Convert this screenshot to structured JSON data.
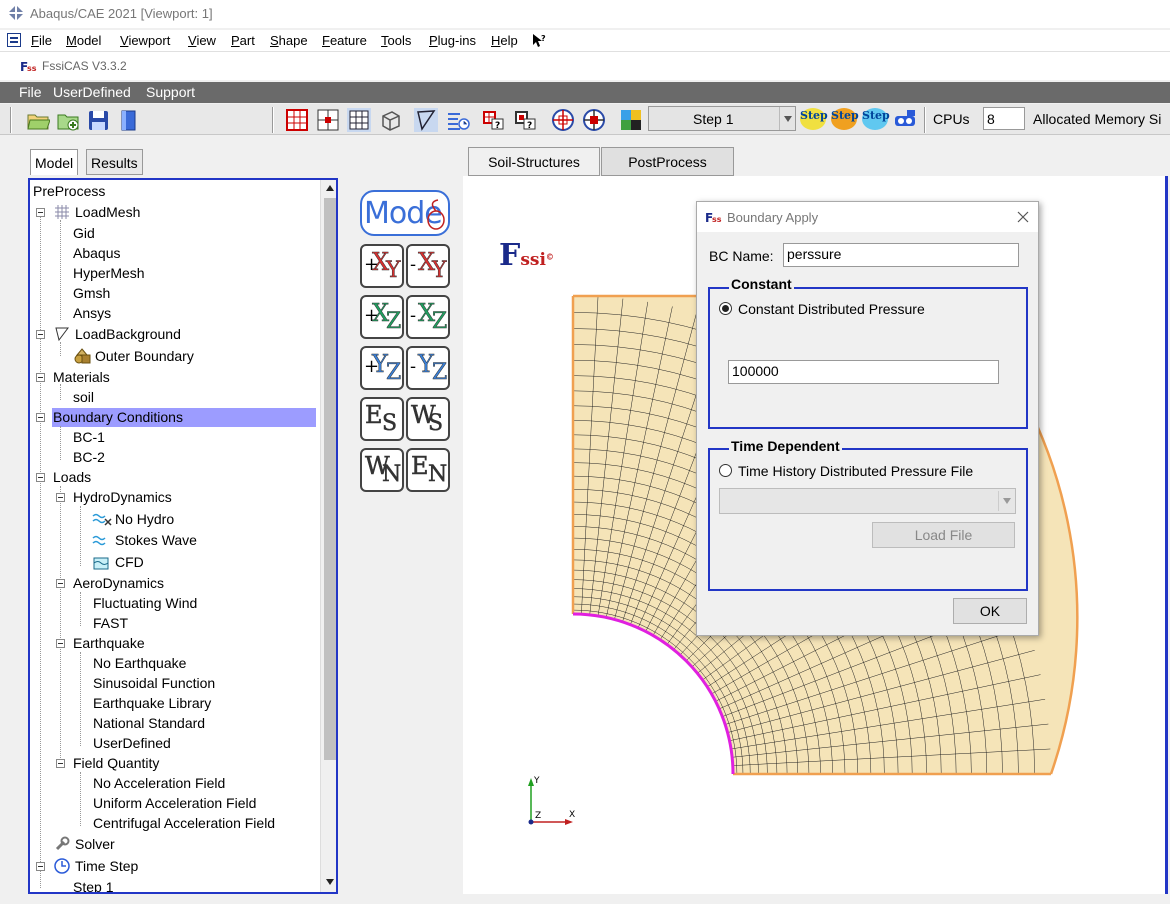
{
  "app": {
    "title": "Abaqus/CAE 2021 [Viewport: 1]"
  },
  "abaqus_menu": [
    "File",
    "Model",
    "Viewport",
    "View",
    "Part",
    "Shape",
    "Feature",
    "Tools",
    "Plug-ins",
    "Help"
  ],
  "fssi": {
    "title": "FssiCAS V3.3.2",
    "menu": [
      "File",
      "UserDefined",
      "Support"
    ]
  },
  "toolbar": {
    "step_select": "Step 1",
    "step_buttons": [
      "Step",
      "Step",
      "Step"
    ],
    "cpus_label": "CPUs",
    "cpus_value": "8",
    "allocated_memory_label": "Allocated Memory Si"
  },
  "left_tabs": [
    "Model",
    "Results"
  ],
  "tree": {
    "root": "PreProcess",
    "items": [
      {
        "label": "LoadMesh"
      },
      {
        "label": "Gid"
      },
      {
        "label": "Abaqus"
      },
      {
        "label": "HyperMesh"
      },
      {
        "label": "Gmsh"
      },
      {
        "label": "Ansys"
      },
      {
        "label": "LoadBackground"
      },
      {
        "label": "Outer Boundary"
      },
      {
        "label": "Materials"
      },
      {
        "label": "soil"
      },
      {
        "label": "Boundary Conditions"
      },
      {
        "label": "BC-1"
      },
      {
        "label": "BC-2"
      },
      {
        "label": "Loads"
      },
      {
        "label": "HydroDynamics"
      },
      {
        "label": "No Hydro"
      },
      {
        "label": "Stokes Wave"
      },
      {
        "label": "CFD"
      },
      {
        "label": "AeroDynamics"
      },
      {
        "label": "Fluctuating Wind"
      },
      {
        "label": "FAST"
      },
      {
        "label": "Earthquake"
      },
      {
        "label": "No Earthquake"
      },
      {
        "label": "Sinusoidal Function"
      },
      {
        "label": "Earthquake Library"
      },
      {
        "label": "National Standard"
      },
      {
        "label": "UserDefined"
      },
      {
        "label": "Field Quantity"
      },
      {
        "label": "No Acceleration Field"
      },
      {
        "label": "Uniform Acceleration Field"
      },
      {
        "label": "Centrifugal Acceleration Field"
      },
      {
        "label": "Solver"
      },
      {
        "label": "Time Step"
      },
      {
        "label": "Step 1"
      }
    ]
  },
  "side_buttons": {
    "mode": "Mode",
    "views": [
      {
        "sign": "+",
        "a": "X",
        "b": "Y"
      },
      {
        "sign": "-",
        "a": "X",
        "b": "Y"
      },
      {
        "sign": "+",
        "a": "X",
        "b": "Z"
      },
      {
        "sign": "-",
        "a": "X",
        "b": "Z"
      },
      {
        "sign": "+",
        "a": "Y",
        "b": "Z"
      },
      {
        "sign": "-",
        "a": "Y",
        "b": "Z"
      },
      {
        "sign": "",
        "a": "E",
        "b": "S"
      },
      {
        "sign": "",
        "a": "W",
        "b": "S"
      },
      {
        "sign": "",
        "a": "W",
        "b": "N"
      },
      {
        "sign": "",
        "a": "E",
        "b": "N"
      }
    ]
  },
  "viewport_tabs": [
    "Soil-Structures",
    "PostProcess"
  ],
  "viewport": {
    "logo_f": "F",
    "logo_rest": "ssi",
    "logo_mark": "©",
    "axis_x": "X",
    "axis_y": "Y",
    "axis_z": "Z"
  },
  "dialog": {
    "title": "Boundary Apply",
    "bc_name_label": "BC Name:",
    "bc_name_value": "perssure",
    "constant_group": "Constant",
    "constant_radio": "Constant Distributed Pressure",
    "constant_value": "100000",
    "time_group": "Time Dependent",
    "time_radio": "Time History Distributed Pressure File",
    "load_file": "Load File",
    "ok": "OK"
  }
}
